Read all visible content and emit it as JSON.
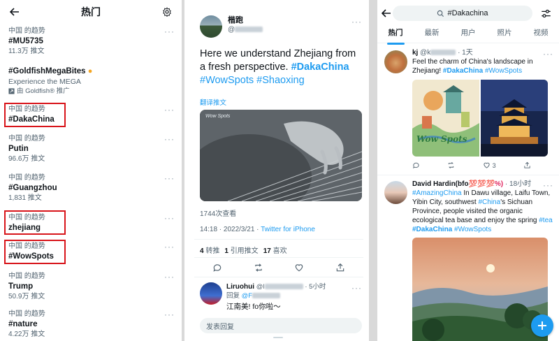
{
  "trends_panel": {
    "title": "热门",
    "trends": [
      {
        "context": "中国 的趋势",
        "name": "#MU5735",
        "count": "11.3万 推文"
      },
      {
        "name": "#GoldfishMegaBites",
        "description": "Experience the MEGA",
        "promoted": "由 Goldfish® 推广"
      },
      {
        "context": "中国 的趋势",
        "name": "#DakaChina"
      },
      {
        "context": "中国 的趋势",
        "name": "Putin",
        "count": "96.6万 推文"
      },
      {
        "context": "中国 的趋势",
        "name": "#Guangzhou",
        "count": "1,831 推文"
      },
      {
        "context": "中国 的趋势",
        "name": "zhejiang"
      },
      {
        "context": "中国 的趋势",
        "name": "#WowSpots"
      },
      {
        "context": "中国 的趋势",
        "name": "Trump",
        "count": "50.9万 推文"
      },
      {
        "context": "中国 的趋势",
        "name": "#nature",
        "count": "4.22万 推文"
      }
    ],
    "highlight_color": "#d8141a"
  },
  "tweet_detail": {
    "author_name": "楷跑",
    "author_handle": "@",
    "text_plain": "Here we understand Zhejiang from a fresh perspective. ",
    "hashtags": [
      "#DakaChina",
      "#WowSpots",
      "#Shaoxing"
    ],
    "translate": "翻译推文",
    "media_logo": "Wow Spots",
    "views": "1744次查看",
    "time": "14:18 · 2022/3/21 · ",
    "client": "Twitter for iPhone",
    "stats": [
      {
        "num": "4",
        "label": "转推"
      },
      {
        "num": "1",
        "label": "引用推文"
      },
      {
        "num": "17",
        "label": "喜欢"
      }
    ],
    "reply": {
      "name": "Liruohui",
      "handle": "@l",
      "time": "· 5小时",
      "reply_to_prefix": "回复 ",
      "reply_to_handle": "@F",
      "text": "江南美! fo你啦～"
    },
    "reply_placeholder": "发表回复"
  },
  "search_panel": {
    "query": "#Dakachina",
    "tabs": [
      "热门",
      "最新",
      "用户",
      "照片",
      "视频"
    ],
    "tweet1": {
      "name": "kj",
      "handle": "@k",
      "time": "· 1天",
      "text": "Feel the charm of China's landscape in Zhejiang! ",
      "hashtags": [
        "#DakaChina",
        "#WowSpots"
      ],
      "image_text": "Wow Spots",
      "likes": "3"
    },
    "tweet2": {
      "name": "David Hardin(bfo",
      "name_emoji": "💯💯💯%)",
      "time": "· 18小时",
      "text_parts": [
        "In Dawu village, Laifu Town, Yibin City, southwest ",
        "'s Sichuan Province, people visited the organic ecological tea base and enjoy the spring "
      ],
      "hashtags": [
        "#AmazingChina",
        "#China",
        "#tea",
        "#DakaChina",
        "#WowSpots"
      ]
    },
    "accent_color": "#1d9bf0"
  }
}
